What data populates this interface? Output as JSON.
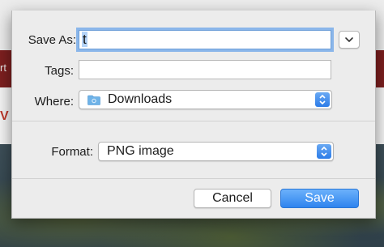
{
  "background": {
    "edge_text": "rt",
    "red_text": "V"
  },
  "dialog": {
    "save_as": {
      "label": "Save As:",
      "value": "t"
    },
    "tags": {
      "label": "Tags:",
      "value": ""
    },
    "where": {
      "label": "Where:",
      "value": "Downloads",
      "icon": "folder-icon"
    },
    "format": {
      "label": "Format:",
      "value": "PNG image"
    },
    "buttons": {
      "cancel": "Cancel",
      "save": "Save"
    }
  },
  "colors": {
    "accent": "#2f84ee",
    "focus_ring": "#8ab6ea",
    "folder": "#6fb3e8"
  }
}
